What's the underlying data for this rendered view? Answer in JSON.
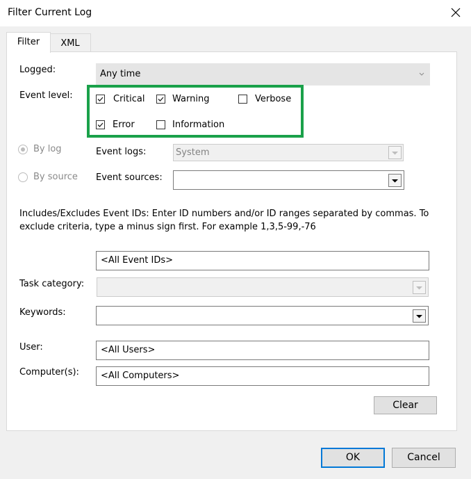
{
  "window": {
    "title": "Filter Current Log"
  },
  "tabs": [
    {
      "label": "Filter"
    },
    {
      "label": "XML"
    }
  ],
  "logged": {
    "label": "Logged:",
    "value": "Any time"
  },
  "event_level": {
    "label": "Event level:",
    "options": [
      {
        "label": "Critical",
        "checked": true
      },
      {
        "label": "Warning",
        "checked": true
      },
      {
        "label": "Verbose",
        "checked": false
      },
      {
        "label": "Error",
        "checked": true
      },
      {
        "label": "Information",
        "checked": false
      }
    ]
  },
  "source": {
    "by_log": "By log",
    "by_source": "By source",
    "event_logs_label": "Event logs:",
    "event_logs_value": "System",
    "event_sources_label": "Event sources:"
  },
  "event_ids": {
    "description": "Includes/Excludes Event IDs: Enter ID numbers and/or ID ranges separated by commas. To exclude criteria, type a minus sign first. For example 1,3,5-99,-76",
    "value": "<All Event IDs>"
  },
  "task_category": {
    "label": "Task category:"
  },
  "keywords": {
    "label": "Keywords:"
  },
  "user": {
    "label": "User:",
    "value": "<All Users>"
  },
  "computer": {
    "label": "Computer(s):",
    "value": "<All Computers>"
  },
  "buttons": {
    "clear": "Clear",
    "ok": "OK",
    "cancel": "Cancel"
  },
  "colors": {
    "highlight": "#1aa14a",
    "default_button_border": "#0078d7"
  }
}
